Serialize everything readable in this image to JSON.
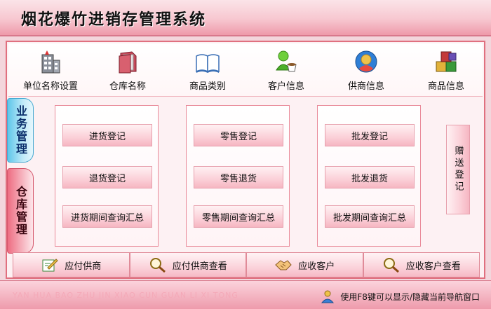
{
  "app": {
    "title": "烟花爆竹进销存管理系统"
  },
  "topnav": {
    "items": [
      {
        "label": "单位名称设置",
        "icon": "building-icon"
      },
      {
        "label": "仓库名称",
        "icon": "folder-icon"
      },
      {
        "label": "商品类别",
        "icon": "book-icon"
      },
      {
        "label": "客户信息",
        "icon": "customer-coffee-icon"
      },
      {
        "label": "供商信息",
        "icon": "globe-user-icon"
      },
      {
        "label": "商品信息",
        "icon": "boxes-icon"
      }
    ]
  },
  "sidetabs": {
    "active": "业务管理",
    "inactive": "仓库管理"
  },
  "panels": {
    "purchase": [
      "进货登记",
      "退货登记",
      "进货期间查询汇总"
    ],
    "retail": [
      "零售登记",
      "零售退货",
      "零售期间查询汇总"
    ],
    "wholesale": [
      "批发登记",
      "批发退货",
      "批发期间查询汇总"
    ]
  },
  "gift": "赠送登记",
  "bottombar": [
    {
      "label": "应付供商",
      "icon": "edit-icon"
    },
    {
      "label": "应付供商查看",
      "icon": "magnifier-icon"
    },
    {
      "label": "应收客户",
      "icon": "handshake-icon"
    },
    {
      "label": "应收客户查看",
      "icon": "magnifier-icon"
    }
  ],
  "status": {
    "pinyin": "YAN HUA BAO ZHU JIN XIAO CUN GUAN LI XI TONG",
    "hint": "使用F8键可以显示/隐藏当前导航窗口"
  },
  "colors": {
    "accent_pink": "#e0707f",
    "active_tab_blue": "#5ec6ea"
  }
}
